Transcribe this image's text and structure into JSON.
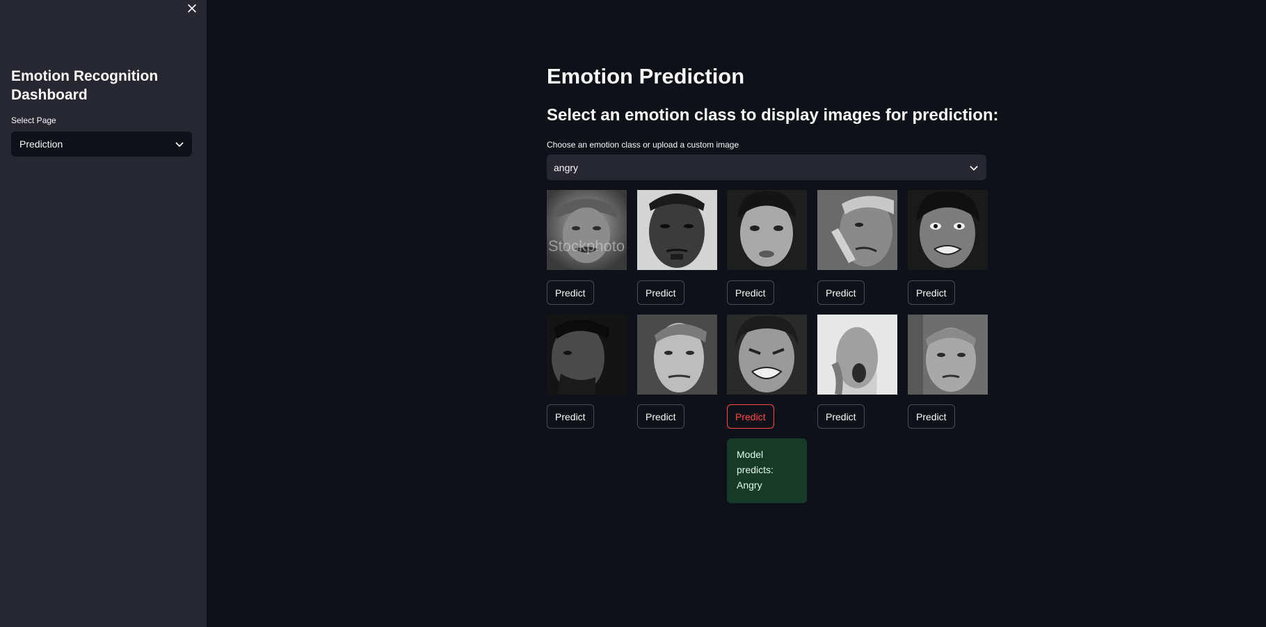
{
  "sidebar": {
    "title": "Emotion Recognition Dashboard",
    "select_label": "Select Page",
    "select_value": "Prediction",
    "close_icon": "close-icon",
    "chevron_icon": "chevron-down-icon",
    "background": "#262730"
  },
  "main": {
    "title": "Emotion Prediction",
    "subheader": "Select an emotion class to display images for prediction:",
    "class_select": {
      "label": "Choose an emotion class or upload a custom image",
      "value": "angry"
    },
    "predict_label": "Predict",
    "images": [
      {
        "image_text": "Stockphoto"
      },
      {},
      {},
      {},
      {},
      {},
      {},
      {},
      {},
      {}
    ],
    "active_predict_index": 7,
    "result": {
      "line1": "Model",
      "line2": "predicts:",
      "line3": "Angry"
    },
    "colors": {
      "accent": "#ff4b4b",
      "background": "#0e1117",
      "success_bg": "#173928"
    }
  }
}
